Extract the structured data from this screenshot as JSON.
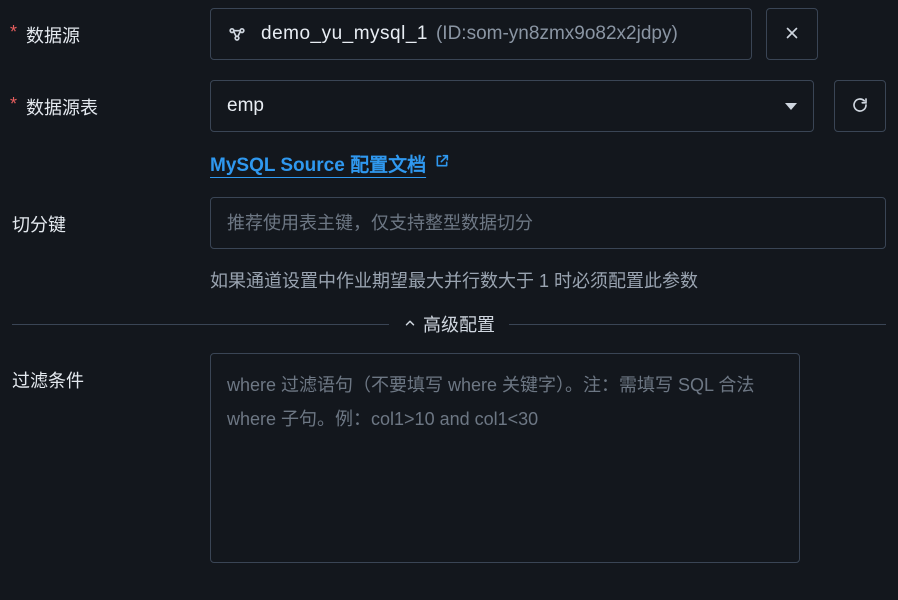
{
  "labels": {
    "datasource": "数据源",
    "datasource_table": "数据源表",
    "split_key": "切分键",
    "filter": "过滤条件"
  },
  "datasource": {
    "name": "demo_yu_mysql_1",
    "id_text": "(ID:som-yn8zmx9o82x2jdpy)"
  },
  "table_select": {
    "value": "emp"
  },
  "doc_link": {
    "text": "MySQL Source 配置文档"
  },
  "split_key": {
    "value": "",
    "placeholder": "推荐使用表主键，仅支持整型数据切分",
    "hint": "如果通道设置中作业期望最大并行数大于 1 时必须配置此参数"
  },
  "advanced_section": {
    "label": "高级配置"
  },
  "filter": {
    "value": "",
    "placeholder": "where 过滤语句（不要填写 where 关键字）。注：需填写 SQL 合法 where 子句。例：col1>10 and col1<30"
  }
}
